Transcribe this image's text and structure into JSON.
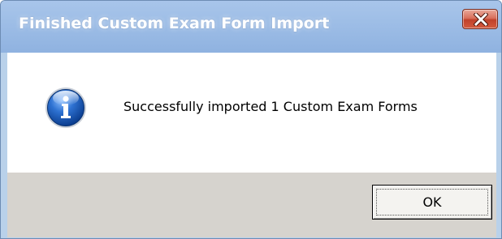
{
  "window": {
    "title": "Finished Custom Exam Form Import"
  },
  "titlebar": {
    "close_icon": "close-icon"
  },
  "dialog": {
    "icon": "info-icon",
    "message": "Successfully imported 1 Custom Exam Forms"
  },
  "buttons": {
    "ok_label": "OK"
  },
  "colors": {
    "titlebar": "#9dbde6",
    "close_button": "#c0412a",
    "footer": "#d6d3ce",
    "info_icon": "#1f5fb8"
  }
}
